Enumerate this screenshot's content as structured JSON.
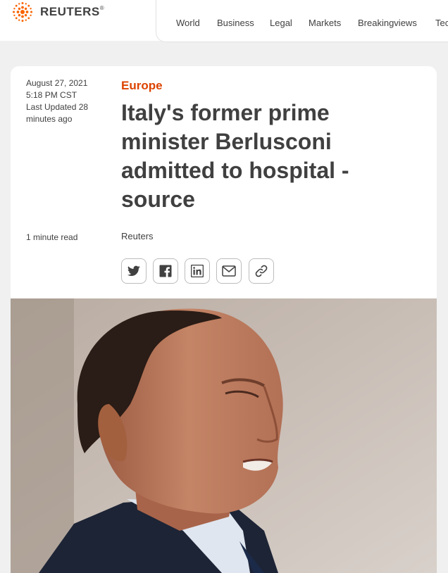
{
  "brand": {
    "name": "REUTERS",
    "reg_mark": "®"
  },
  "nav": {
    "items": [
      {
        "label": "World"
      },
      {
        "label": "Business"
      },
      {
        "label": "Legal"
      },
      {
        "label": "Markets"
      },
      {
        "label": "Breakingviews"
      },
      {
        "label": "Tec"
      }
    ]
  },
  "article": {
    "date": "August 27, 2021",
    "time": "5:18 PM CST",
    "updated": "Last Updated 28 minutes ago",
    "read_time": "1 minute read",
    "section": "Europe",
    "headline": "Italy's former prime minister Berlusconi admitted to hospital - source",
    "author": "Reuters"
  },
  "share": {
    "icons": [
      "twitter-icon",
      "facebook-icon",
      "linkedin-icon",
      "email-icon",
      "link-icon"
    ]
  },
  "colors": {
    "accent": "#dc4300",
    "text": "#404040",
    "logo_orange": "#fa6400"
  }
}
